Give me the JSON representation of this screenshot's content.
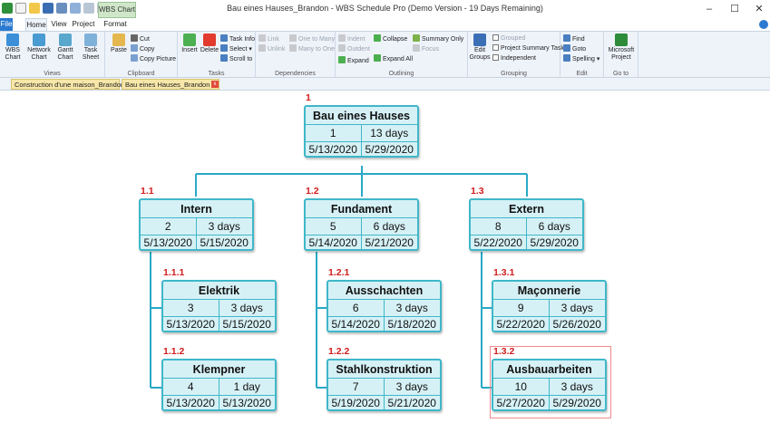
{
  "window": {
    "title": "Bau eines Hauses_Brandon - WBS Schedule Pro (Demo Version - 19 Days Remaining)",
    "context_tab": "WBS Chart",
    "controls": [
      "–",
      "☐",
      "✕"
    ]
  },
  "tabs": [
    "File",
    "Home",
    "View",
    "Project",
    "Format"
  ],
  "ribbon": {
    "views": {
      "label": "Views",
      "wbs_chart": "WBS Chart",
      "network_chart": "Network Chart",
      "gantt_chart": "Gantt Chart",
      "task_sheet": "Task Sheet"
    },
    "clipboard": {
      "label": "Clipboard",
      "paste": "Paste",
      "cut": "Cut",
      "copy": "Copy",
      "copy_picture": "Copy Picture"
    },
    "tasks": {
      "label": "Tasks",
      "insert": "Insert",
      "delete": "Delete",
      "task_info": "Task Info",
      "select": "Select",
      "scroll_to": "Scroll to"
    },
    "dependencies": {
      "label": "Dependencies",
      "link": "Link",
      "unlink": "Unlink",
      "one_to_many": "One to Many",
      "many_to_one": "Many to One"
    },
    "outlining": {
      "label": "Outlining",
      "indent": "Indent",
      "outdent": "Outdent",
      "expand": "Expand",
      "collapse": "Collapse",
      "expand_all": "Expand All",
      "summary_only": "Summary Only",
      "focus": "Focus"
    },
    "grouping": {
      "label": "Grouping",
      "edit_groups": "Edit Groups",
      "grouped": "Grouped",
      "project_summary_task": "Project Summary Task",
      "independent": "Independent"
    },
    "edit": {
      "label": "Edit",
      "find": "Find",
      "goto": "Goto",
      "spelling": "Spelling"
    },
    "goto": {
      "label": "Go to",
      "ms_project": "Microsoft Project"
    }
  },
  "doc_tabs": [
    "Construction d'une maison_Brandon",
    "Bau eines Hauses_Brandon"
  ],
  "doc_tab_close": "x",
  "colors": {
    "node_fill": "#d6f1f6",
    "node_border": "#3fb7c9",
    "wbs_number": "#d21c1c",
    "connector": "#29a8c5"
  },
  "nodes": [
    {
      "wbs": "1",
      "name": "Bau eines Hauses",
      "id": "1",
      "duration": "13 days",
      "start": "5/13/2020",
      "end": "5/29/2020"
    },
    {
      "wbs": "1.1",
      "name": "Intern",
      "id": "2",
      "duration": "3 days",
      "start": "5/13/2020",
      "end": "5/15/2020"
    },
    {
      "wbs": "1.1.1",
      "name": "Elektrik",
      "id": "3",
      "duration": "3 days",
      "start": "5/13/2020",
      "end": "5/15/2020"
    },
    {
      "wbs": "1.1.2",
      "name": "Klempner",
      "id": "4",
      "duration": "1 day",
      "start": "5/13/2020",
      "end": "5/13/2020"
    },
    {
      "wbs": "1.2",
      "name": "Fundament",
      "id": "5",
      "duration": "6 days",
      "start": "5/14/2020",
      "end": "5/21/2020"
    },
    {
      "wbs": "1.2.1",
      "name": "Ausschachten",
      "id": "6",
      "duration": "3 days",
      "start": "5/14/2020",
      "end": "5/18/2020"
    },
    {
      "wbs": "1.2.2",
      "name": "Stahlkonstruktion",
      "id": "7",
      "duration": "3 days",
      "start": "5/19/2020",
      "end": "5/21/2020"
    },
    {
      "wbs": "1.3",
      "name": "Extern",
      "id": "8",
      "duration": "6 days",
      "start": "5/22/2020",
      "end": "5/29/2020"
    },
    {
      "wbs": "1.3.1",
      "name": "Maçonnerie",
      "id": "9",
      "duration": "3 days",
      "start": "5/22/2020",
      "end": "5/26/2020"
    },
    {
      "wbs": "1.3.2",
      "name": "Ausbauarbeiten",
      "id": "10",
      "duration": "3 days",
      "start": "5/27/2020",
      "end": "5/29/2020"
    }
  ]
}
